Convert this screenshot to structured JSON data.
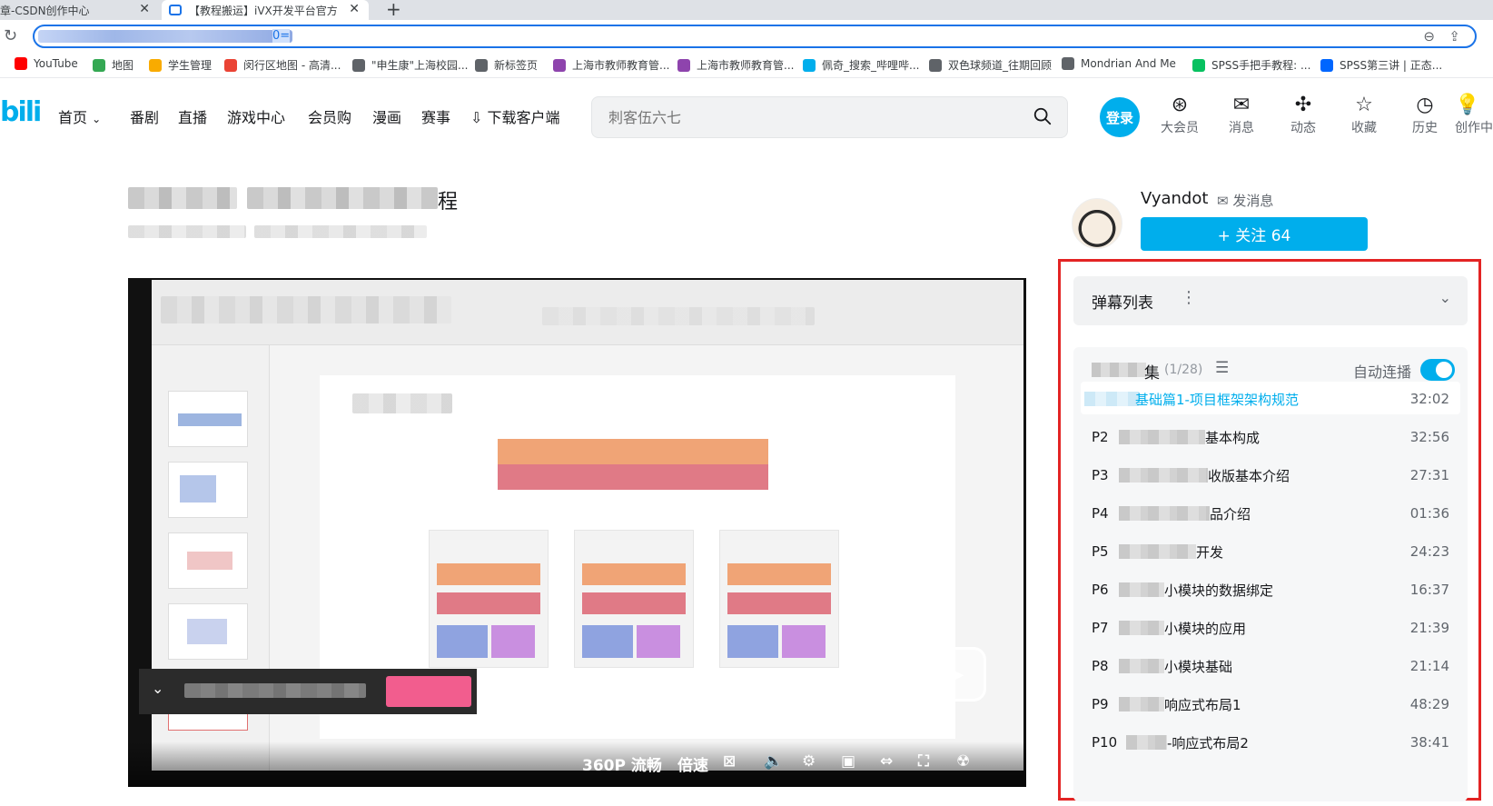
{
  "browser": {
    "tabs": [
      {
        "label": "章-CSDN创作中心"
      },
      {
        "label": "【教程搬运】iVX开发平台官方"
      }
    ],
    "url_tail": "0=",
    "bookmarks": [
      {
        "label": "YouTube",
        "color": "#ff0000"
      },
      {
        "label": "地图",
        "color": "#34a853"
      },
      {
        "label": "学生管理",
        "color": "#f9ab00"
      },
      {
        "label": "闵行区地图 - 高清...",
        "color": "#ea4335"
      },
      {
        "label": "\"申生康\"上海校园...",
        "color": "#5f6368"
      },
      {
        "label": "新标签页",
        "color": "#5f6368"
      },
      {
        "label": "上海市教师教育管...",
        "color": "#8e44ad"
      },
      {
        "label": "上海市教师教育管...",
        "color": "#8e44ad"
      },
      {
        "label": "佩奇_搜索_哔哩哔...",
        "color": "#00aeec"
      },
      {
        "label": "双色球频道_往期回顾",
        "color": "#5f6368"
      },
      {
        "label": "Mondrian And Me",
        "color": "#5f6368"
      },
      {
        "label": "SPSS手把手教程: ...",
        "color": "#07c160"
      },
      {
        "label": "SPSS第三讲 | 正态...",
        "color": "#0066ff"
      }
    ]
  },
  "header": {
    "logo": "bili",
    "nav": [
      "首页",
      "番剧",
      "直播",
      "游戏中心",
      "会员购",
      "漫画",
      "赛事",
      "下载客户端"
    ],
    "search_placeholder": "刺客伍六七",
    "login": "登录",
    "icons": [
      {
        "label": "大会员",
        "glyph": "⊛"
      },
      {
        "label": "消息",
        "glyph": "✉"
      },
      {
        "label": "动态",
        "glyph": "✣"
      },
      {
        "label": "收藏",
        "glyph": "☆"
      },
      {
        "label": "历史",
        "glyph": "◷"
      },
      {
        "label": "创作中",
        "glyph": "💡"
      }
    ]
  },
  "video": {
    "title_tail": "程",
    "controls": {
      "quality": "360P 流畅",
      "speed": "倍速"
    }
  },
  "uploader": {
    "name": "Vyandot",
    "message": "发消息",
    "follow": "+ 关注 64"
  },
  "danmaku": {
    "label": "弹幕列表"
  },
  "playlist": {
    "title": "集",
    "count": "(1/28)",
    "autoplay_label": "自动连播",
    "autoplay_on": true,
    "episodes": [
      {
        "num": "",
        "title": "基础篇1-项目框架架构规范",
        "duration": "32:02",
        "active": true
      },
      {
        "num": "P2",
        "title": "基本构成",
        "duration": "32:56"
      },
      {
        "num": "P3",
        "title": "收版基本介绍",
        "duration": "27:31"
      },
      {
        "num": "P4",
        "title": "品介绍",
        "duration": "01:36"
      },
      {
        "num": "P5",
        "title": "开发",
        "duration": "24:23"
      },
      {
        "num": "P6",
        "title": "小模块的数据绑定",
        "duration": "16:37"
      },
      {
        "num": "P7",
        "title": "小模块的应用",
        "duration": "21:39"
      },
      {
        "num": "P8",
        "title": "小模块基础",
        "duration": "21:14"
      },
      {
        "num": "P9",
        "title": "响应式布局1",
        "duration": "48:29"
      },
      {
        "num": "P10",
        "title": "-响应式布局2",
        "duration": "38:41"
      }
    ]
  }
}
